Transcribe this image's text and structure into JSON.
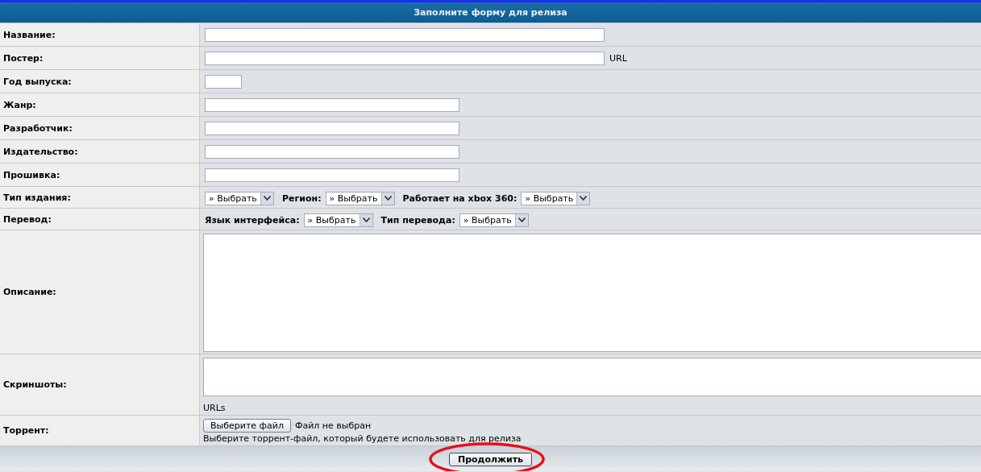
{
  "form": {
    "title": "Заполните форму для релиза",
    "rows": [
      {
        "kind": "longline",
        "label": "Название:"
      },
      {
        "kind": "longline",
        "label": "Постер:",
        "suffix": "URL"
      },
      {
        "kind": "tinyline",
        "label": "Год выпуска:"
      },
      {
        "kind": "midline",
        "label": "Жанр:"
      },
      {
        "kind": "midline",
        "label": "Разработчик:"
      },
      {
        "kind": "midline",
        "label": "Издательство:"
      },
      {
        "kind": "midline",
        "label": "Прошивка:"
      },
      {
        "kind": "selects",
        "label": "Тип издания:",
        "selects": [
          {
            "value": "» Выбрать"
          },
          {
            "label": "Регион:",
            "value": "» Выбрать"
          },
          {
            "label": "Работает на xbox 360:",
            "value": "» Выбрать"
          }
        ]
      },
      {
        "kind": "selects",
        "label": "Перевод:",
        "selects": [
          {
            "label": "Язык интерфейса:",
            "value": "» Выбрать"
          },
          {
            "label": "Тип перевода:",
            "value": "» Выбрать"
          }
        ]
      },
      {
        "kind": "bigarea",
        "label": "Описание:"
      },
      {
        "kind": "smallarea",
        "label": "Скриншоты:",
        "note": "URLs"
      },
      {
        "kind": "file",
        "label": "Торрент:",
        "button": "Выберите файл",
        "status": "Файл не выбран",
        "note": "Выберите торрент-файл, который будете использовать для релиза"
      }
    ],
    "submit": {
      "label": "Продолжить",
      "highlighted": true
    }
  }
}
